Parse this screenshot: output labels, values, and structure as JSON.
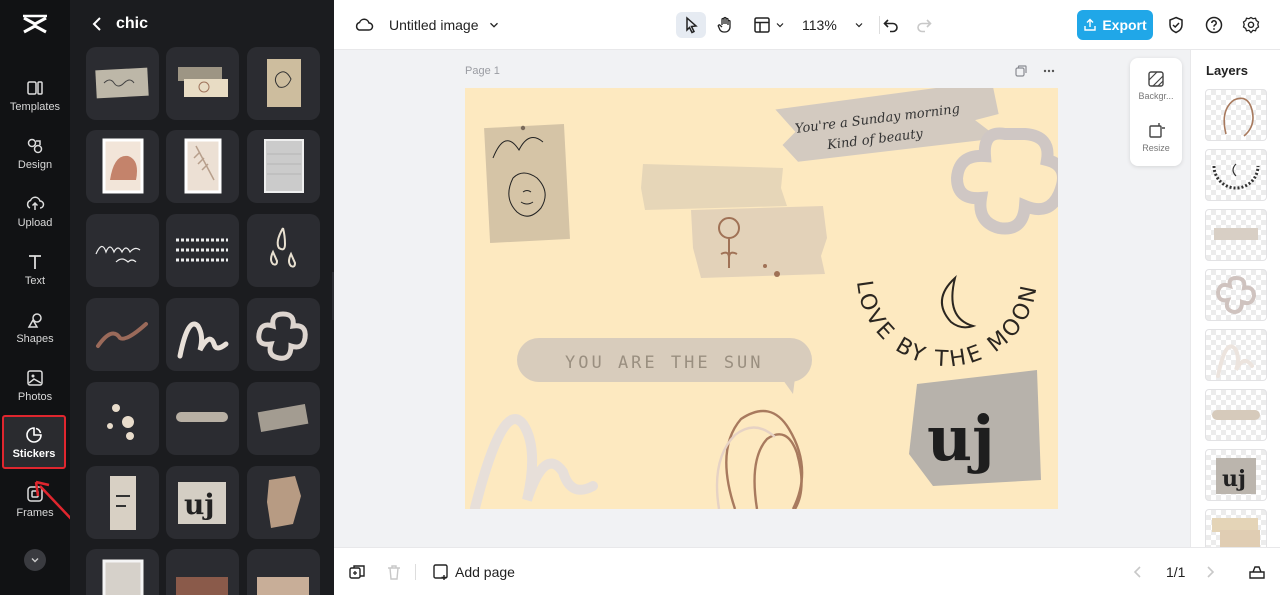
{
  "rail": {
    "items": [
      {
        "label": "Templates",
        "icon": "templates-icon"
      },
      {
        "label": "Design",
        "icon": "design-icon"
      },
      {
        "label": "Upload",
        "icon": "upload-icon"
      },
      {
        "label": "Text",
        "icon": "text-icon"
      },
      {
        "label": "Shapes",
        "icon": "shapes-icon"
      },
      {
        "label": "Photos",
        "icon": "photos-icon"
      },
      {
        "label": "Stickers",
        "icon": "stickers-icon"
      },
      {
        "label": "Frames",
        "icon": "frames-icon"
      }
    ],
    "active": "Stickers"
  },
  "panel": {
    "title": "chic",
    "stickers": [
      "torn-paper-handwriting",
      "torn-tape-strips",
      "paper-sketch",
      "abstract-photo",
      "palm-leaf-photo",
      "grey-texture",
      "afternoon-tea-script",
      "text-strips",
      "water-drops",
      "brush-stroke",
      "squiggle-line",
      "flower-outline",
      "paint-dots",
      "speech-bubble-strip",
      "torn-tape-grey",
      "torn-letter-paper",
      "uj-lettering",
      "torn-brown-paper",
      "photo-frame",
      "brown-paper",
      "beige-tape"
    ]
  },
  "topbar": {
    "doc_title": "Untitled image",
    "zoom": "113%",
    "export_label": "Export"
  },
  "workspace": {
    "page_label": "Page 1",
    "canvas_text": {
      "note_line1": "You're a Sunday morning",
      "note_line2": "Kind of beauty",
      "bubble": "YOU ARE THE SUN",
      "arc": "LOVE BY THE MOON",
      "letters": "uj"
    },
    "float_tools": [
      {
        "label": "Backgr...",
        "icon": "background-icon"
      },
      {
        "label": "Resize",
        "icon": "resize-icon"
      }
    ]
  },
  "layers": {
    "title": "Layers",
    "items": [
      "squiggle-outline",
      "love-by-the-moon",
      "note-strip",
      "flower",
      "squiggle-line",
      "bubble-strip",
      "uj-letters",
      "tape-strips"
    ]
  },
  "bottombar": {
    "add_page": "Add page",
    "page_counter": "1/1"
  },
  "colors": {
    "accent": "#20a7e8",
    "canvas_bg": "#fde9c0",
    "active_outline": "#e0262e"
  }
}
